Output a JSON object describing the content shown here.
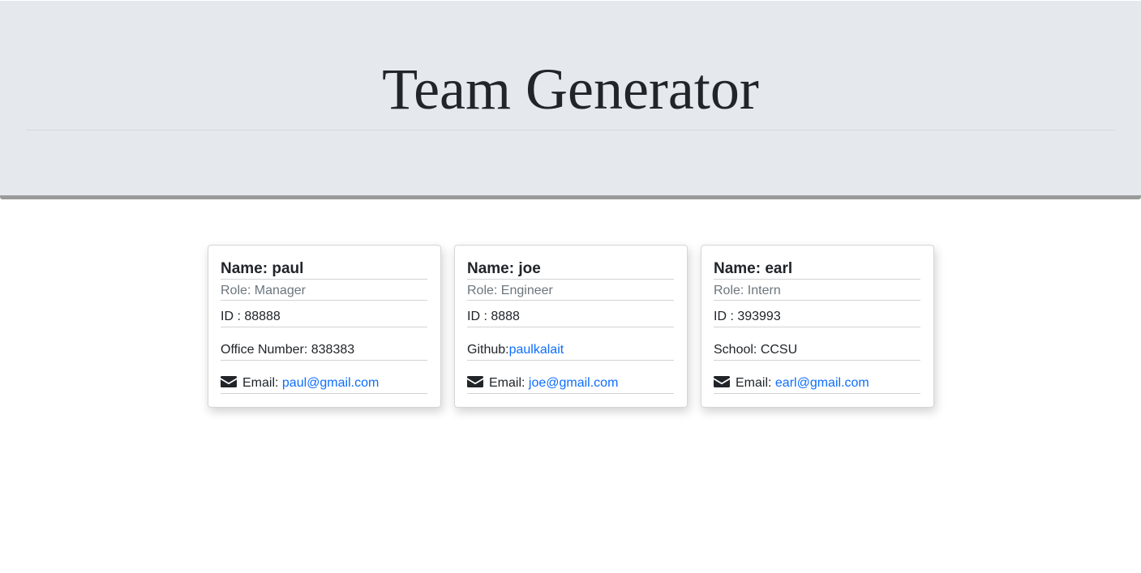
{
  "header": {
    "title": "Team Generator"
  },
  "icons": {
    "email": "envelope-icon"
  },
  "colors": {
    "link": "#0d6efd",
    "header_bg": "#e5e8ec"
  },
  "cards": [
    {
      "name": "Name: paul",
      "role": "Role: Manager",
      "id": "ID : 88888",
      "extra_label": "Office Number: 838383",
      "extra_link": "",
      "email_label": "Email: ",
      "email": "paul@gmail.com"
    },
    {
      "name": "Name: joe",
      "role": "Role: Engineer",
      "id": "ID : 8888",
      "extra_label": "Github:",
      "extra_link": "paulkalait",
      "email_label": "Email: ",
      "email": "joe@gmail.com"
    },
    {
      "name": "Name: earl",
      "role": "Role: Intern",
      "id": "ID : 393993",
      "extra_label": "School: CCSU",
      "extra_link": "",
      "email_label": "Email: ",
      "email": "earl@gmail.com"
    }
  ]
}
